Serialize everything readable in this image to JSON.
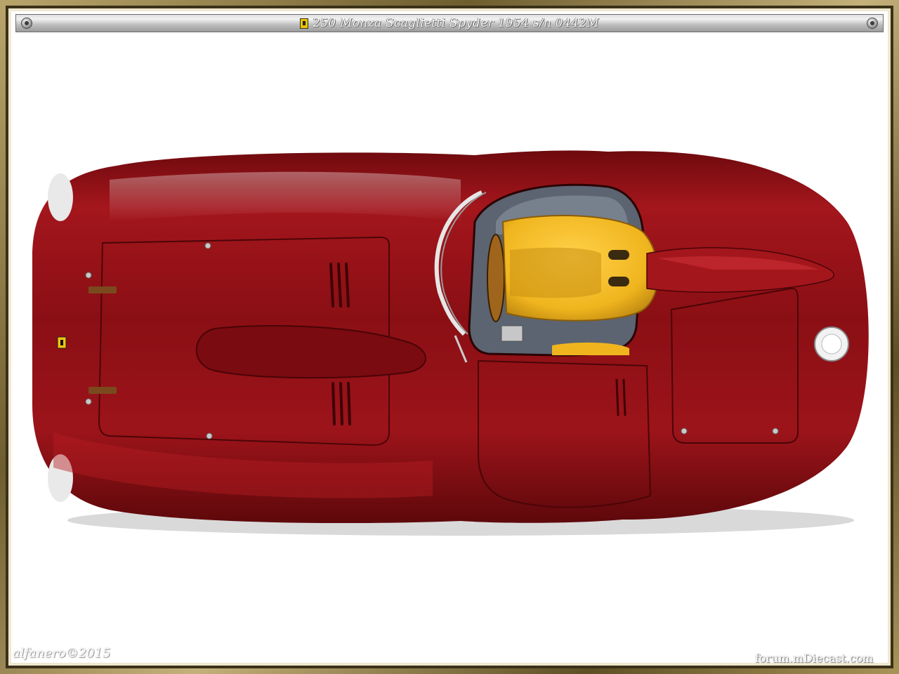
{
  "title": "250 Monza Scaglietti Spyder 1954  s/n 0442M",
  "watermarks": {
    "signature": "alfanero©2015",
    "forum": "forum.mDiecast.com"
  },
  "colors": {
    "car_body": "#8e0d12",
    "seat": "#f0b51e",
    "background": "#ffffff",
    "frame": "#a8945c"
  },
  "icons": [
    "ferrari-badge-icon",
    "screw-icon"
  ]
}
